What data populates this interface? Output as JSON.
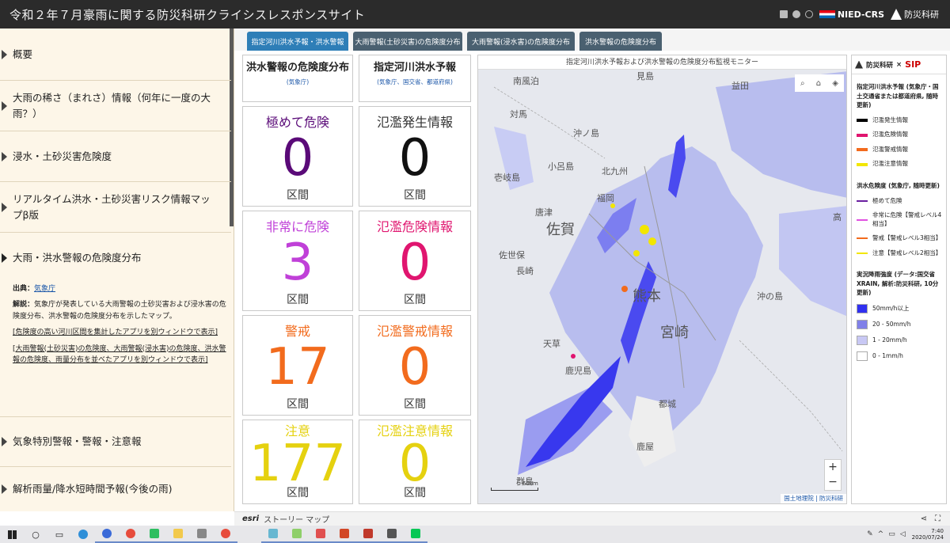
{
  "header": {
    "title": "令和２年７月豪雨に関する防災科研クライシスレスポンスサイト",
    "logo_nied": "NIED-CRS",
    "logo_bosai": "防災科研"
  },
  "sidebar": {
    "items": [
      {
        "label": "概要"
      },
      {
        "label": "大雨の稀さ（まれさ）情報（何年に一度の大雨？）"
      },
      {
        "label": "浸水・土砂災害危険度"
      },
      {
        "label": "リアルタイム洪水・土砂災害リスク情報マップβ版"
      },
      {
        "label": "大雨・洪水警報の危険度分布"
      },
      {
        "label": "気象特別警報・警報・注意報"
      },
      {
        "label": "解析雨量/降水短時間予報(今後の雨)"
      }
    ],
    "detail": {
      "source_label": "出典：",
      "source_link": "気象庁",
      "desc_label": "解説：",
      "desc": "気象庁が発表している大雨警報の土砂災害および浸水害の危険度分布、洪水警報の危険度分布を示したマップ。",
      "link1": "[危険度の高い河川区間を集計したアプリを別ウィンドウで表示]",
      "link2": "[大雨警報(土砂災害)の危険度、大雨警報(浸水害)の危険度、洪水警報の危険度、雨量分布を並べたアプリを別ウィンドウで表示]"
    }
  },
  "tabs": [
    {
      "label": "指定河川洪水予報・洪水警報"
    },
    {
      "label": "大雨警報(土砂災害)の危険度分布"
    },
    {
      "label": "大雨警報(浸水害)の危険度分布"
    },
    {
      "label": "洪水警報の危険度分布"
    }
  ],
  "panel_left": {
    "title": "洪水警報の危険度分布",
    "source": "(気象庁)",
    "stats": [
      {
        "label": "極めて危険",
        "value": "0",
        "unit": "区間",
        "color": "#5a0a78"
      },
      {
        "label": "非常に危険",
        "value": "3",
        "unit": "区間",
        "color": "#c040d8"
      },
      {
        "label": "警戒",
        "value": "17",
        "unit": "区間",
        "color": "#f26b1d"
      },
      {
        "label": "注意",
        "value": "177",
        "unit": "区間",
        "color": "#e5d10f"
      }
    ]
  },
  "panel_right": {
    "title": "指定河川洪水予報",
    "source": "(気象庁、国交省、都道府県)",
    "stats": [
      {
        "label": "氾濫発生情報",
        "value": "0",
        "unit": "区間",
        "color": "#111111"
      },
      {
        "label": "氾濫危険情報",
        "value": "0",
        "unit": "区間",
        "color": "#e0156f"
      },
      {
        "label": "氾濫警戒情報",
        "value": "0",
        "unit": "区間",
        "color": "#f26b1d"
      },
      {
        "label": "氾濫注意情報",
        "value": "0",
        "unit": "区間",
        "color": "#e5d10f"
      }
    ]
  },
  "map": {
    "caption": "指定河川洪水予報および洪水警報の危険度分布監視モニター",
    "attribution": "国土地理院 | 防災科研",
    "scale": "60km",
    "labels": [
      "南風泊",
      "見島",
      "益田",
      "対馬",
      "沖ノ島",
      "小呂島",
      "北九州",
      "壱岐島",
      "福岡",
      "唐津",
      "佐賀",
      "佐世保",
      "長崎",
      "熊本",
      "天草",
      "宮崎",
      "鹿児島",
      "都城",
      "鹿屋",
      "群島",
      "沖の島",
      "高"
    ]
  },
  "legend": {
    "brand": "防災科研",
    "brand2": "SIP",
    "sec1": "指定河川洪水予報 (気象庁・国土交通省または都道府県, 随時更新)",
    "sec1_items": [
      {
        "label": "氾濫発生情報",
        "color": "#000000"
      },
      {
        "label": "氾濫危険情報",
        "color": "#e0156f"
      },
      {
        "label": "氾濫警戒情報",
        "color": "#f26b1d"
      },
      {
        "label": "氾濫注意情報",
        "color": "#f2e600"
      }
    ],
    "sec2": "洪水危険度 (気象庁, 随時更新)",
    "sec2_items": [
      {
        "label": "極めて危険",
        "color": "#6a1fa0"
      },
      {
        "label": "非常に危険【警戒レベル4相当】",
        "color": "#e050e0"
      },
      {
        "label": "警戒【警戒レベル3相当】",
        "color": "#f26b1d"
      },
      {
        "label": "注意【警戒レベル2相当】",
        "color": "#f2e600"
      }
    ],
    "sec3": "実況降雨強度 (データ:国交省XRAIN, 解析:防災科研, 10分更新)",
    "sec3_items": [
      {
        "label": "50mm/h以上",
        "color": "#3030f0"
      },
      {
        "label": "20 - 50mm/h",
        "color": "#8080e8"
      },
      {
        "label": "1 - 20mm/h",
        "color": "#c8c8f4"
      },
      {
        "label": "0 - 1mm/h",
        "color": "#ffffff"
      }
    ]
  },
  "story": {
    "brand": "esri",
    "label": "ストーリー マップ"
  },
  "taskbar": {
    "time": "7:40",
    "date": "2020/07/24"
  }
}
